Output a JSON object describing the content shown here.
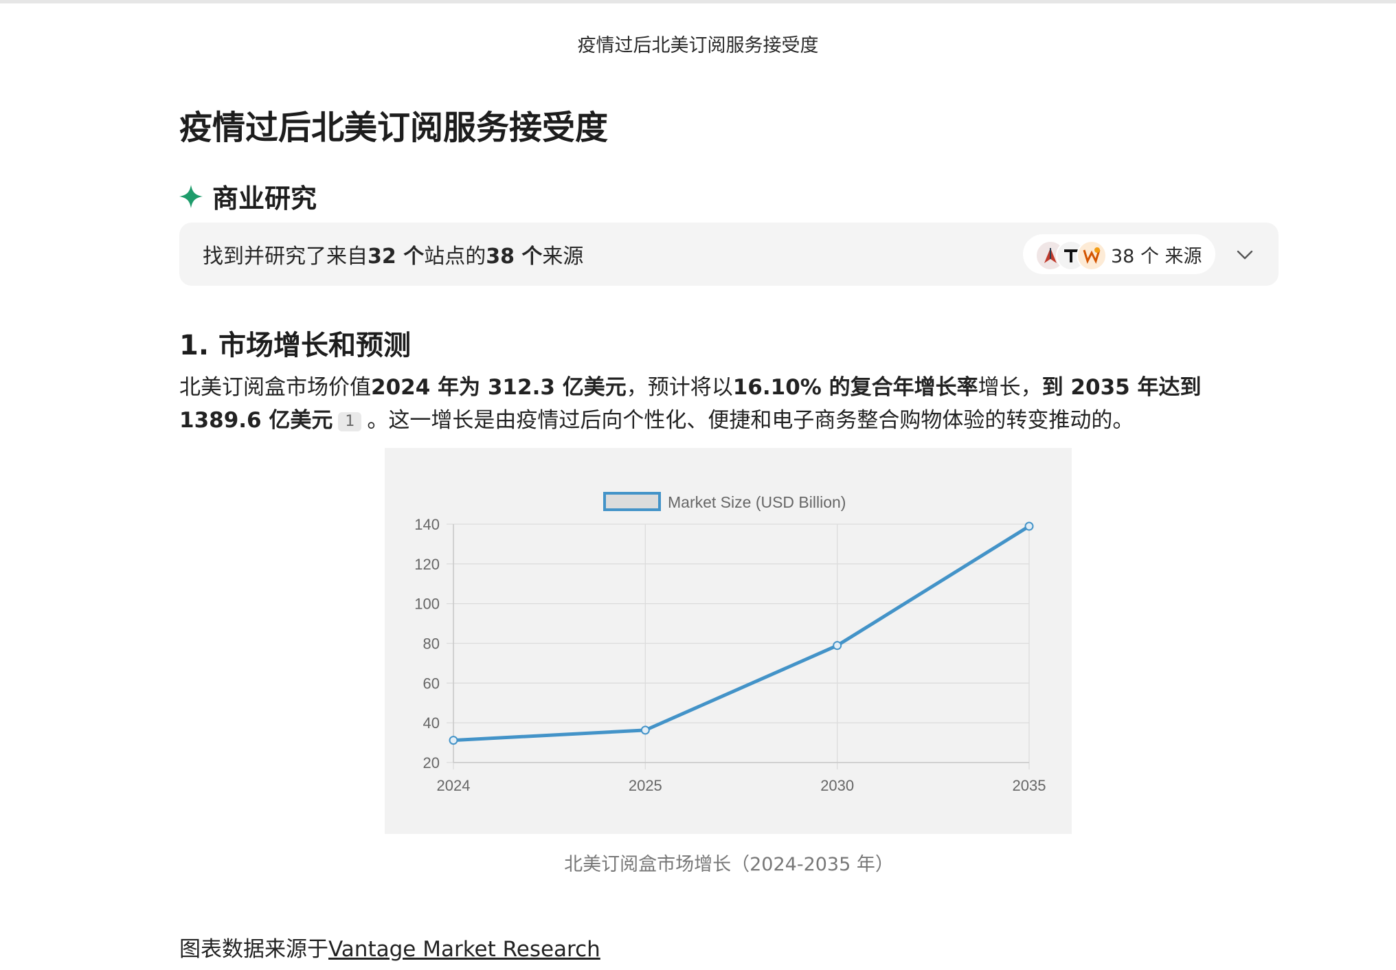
{
  "window": {
    "title": "疫情过后北美订阅服务接受度"
  },
  "page": {
    "title": "疫情过后北美订阅服务接受度",
    "section_label": "商业研究"
  },
  "sources": {
    "prefix": "找到并研究了来自",
    "sites_count": "32 个",
    "middle": "站点的",
    "sources_count": "38 个",
    "suffix": "来源",
    "pill_label": "38 个 来源",
    "icons": [
      "source-icon-a",
      "source-icon-b",
      "source-icon-c"
    ]
  },
  "section1": {
    "heading": "1. 市场增长和预测",
    "p_part1": "北美订阅盒市场价值",
    "p_bold1": "2024 年为 312.3 亿美元",
    "p_part2": "，预计将以",
    "p_bold2": "16.10% 的复合年增长率",
    "p_part3": "增长，",
    "p_bold3": "到 2035 年达到 1389.6 亿美元",
    "citation": "1",
    "p_part4": "。这一增长是由疫情过后向个性化、便捷和电子商务整合购物体验的转变推动的。"
  },
  "chart_data": {
    "type": "line",
    "categories": [
      "2024",
      "2025",
      "2030",
      "2035"
    ],
    "series": [
      {
        "name": "Market Size (USD Billion)",
        "values": [
          31.2,
          36.3,
          78.9,
          138.96
        ],
        "color": "#4393c8"
      }
    ],
    "yticks": [
      20,
      40,
      60,
      80,
      100,
      120,
      140
    ],
    "ylim": [
      20,
      140
    ],
    "grid": true,
    "legend": "top-center"
  },
  "chart": {
    "caption": "北美订阅盒市场增长（2024-2035 年）"
  },
  "footer": {
    "prefix": "图表数据来源于",
    "link_text": "Vantage Market Research"
  }
}
